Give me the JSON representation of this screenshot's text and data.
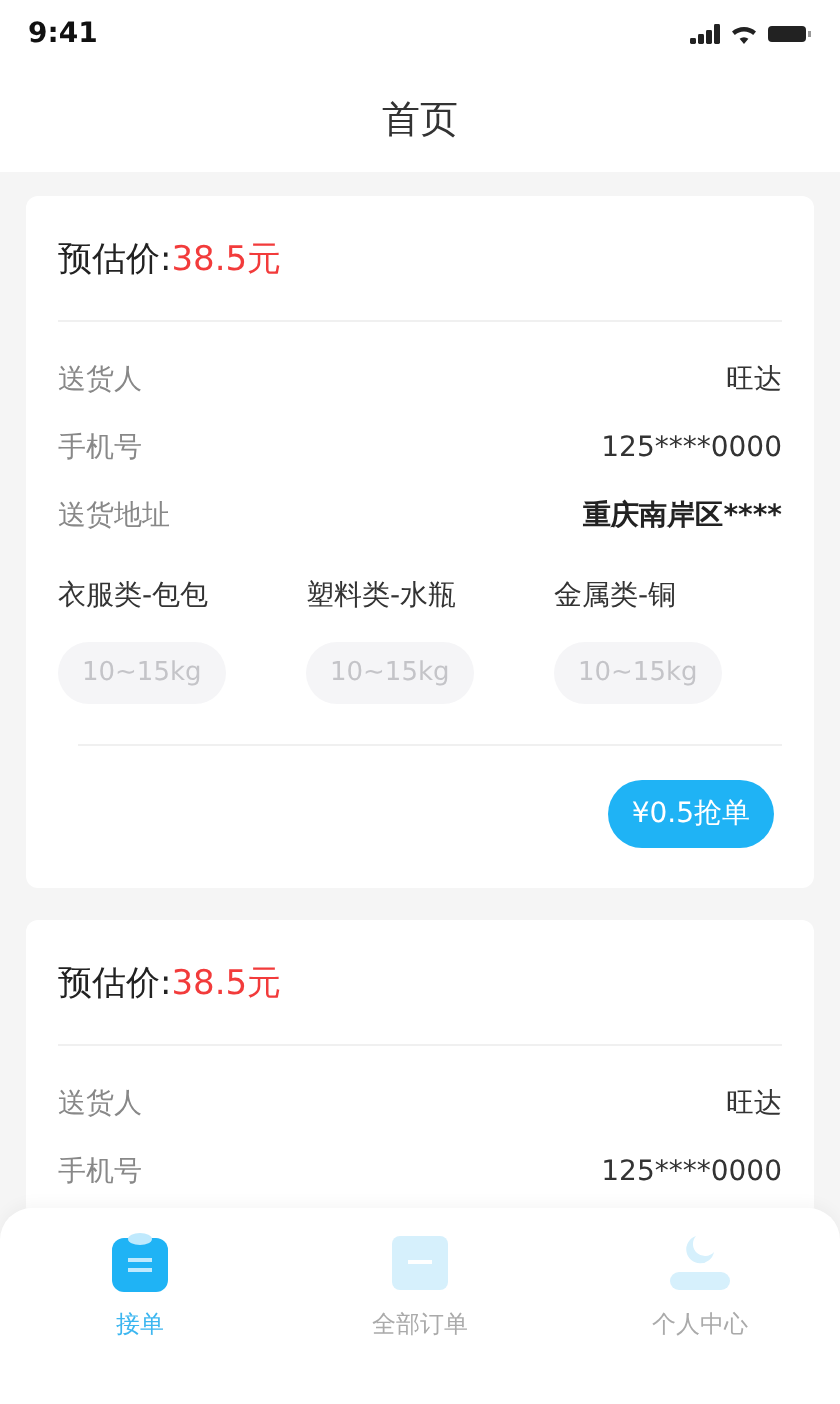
{
  "status_bar": {
    "time": "9:41"
  },
  "title": "首页",
  "orders": [
    {
      "price_label": "预估价:",
      "price": "38.5元",
      "fields": [
        {
          "label": "送货人",
          "value": "旺达",
          "bold": false
        },
        {
          "label": "手机号",
          "value": "125****0000",
          "bold": false
        },
        {
          "label": "送货地址",
          "value": "重庆南岸区****",
          "bold": true
        }
      ],
      "items": [
        {
          "name": "衣服类-包包",
          "weight": "10~15kg"
        },
        {
          "name": "塑料类-水瓶",
          "weight": "10~15kg"
        },
        {
          "name": "金属类-铜",
          "weight": "10~15kg"
        }
      ],
      "action": "¥0.5抢单"
    },
    {
      "price_label": "预估价:",
      "price": "38.5元",
      "fields": [
        {
          "label": "送货人",
          "value": "旺达",
          "bold": false
        },
        {
          "label": "手机号",
          "value": "125****0000",
          "bold": false
        }
      ]
    }
  ],
  "tabs": [
    {
      "label": "接单",
      "selected": true
    },
    {
      "label": "全部订单",
      "selected": false
    },
    {
      "label": "个人中心",
      "selected": false
    }
  ]
}
